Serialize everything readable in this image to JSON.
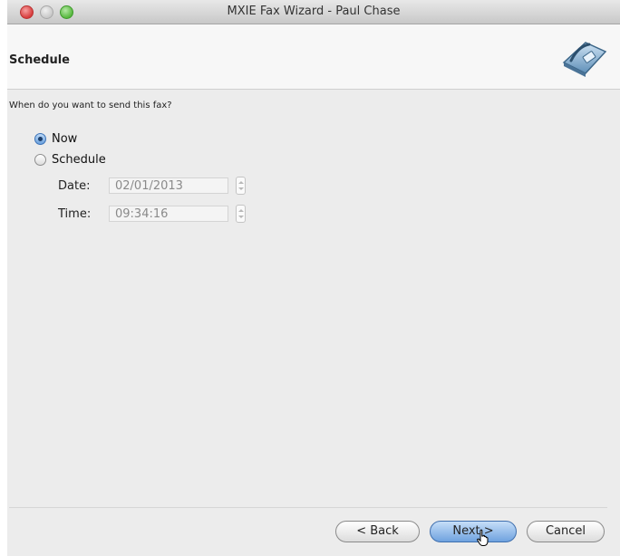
{
  "window": {
    "title": "MXIE Fax Wizard - Paul Chase"
  },
  "header": {
    "title": "Schedule",
    "icon": "fax-machine-icon"
  },
  "schedule": {
    "question": "When do you want to send this fax?",
    "options": [
      {
        "label": "Now",
        "checked": true
      },
      {
        "label": "Schedule",
        "checked": false
      }
    ],
    "date_label": "Date:",
    "date_value": "02/01/2013",
    "time_label": "Time:",
    "time_value": "09:34:16"
  },
  "buttons": {
    "back": "< Back",
    "next": "Next >",
    "cancel": "Cancel"
  }
}
